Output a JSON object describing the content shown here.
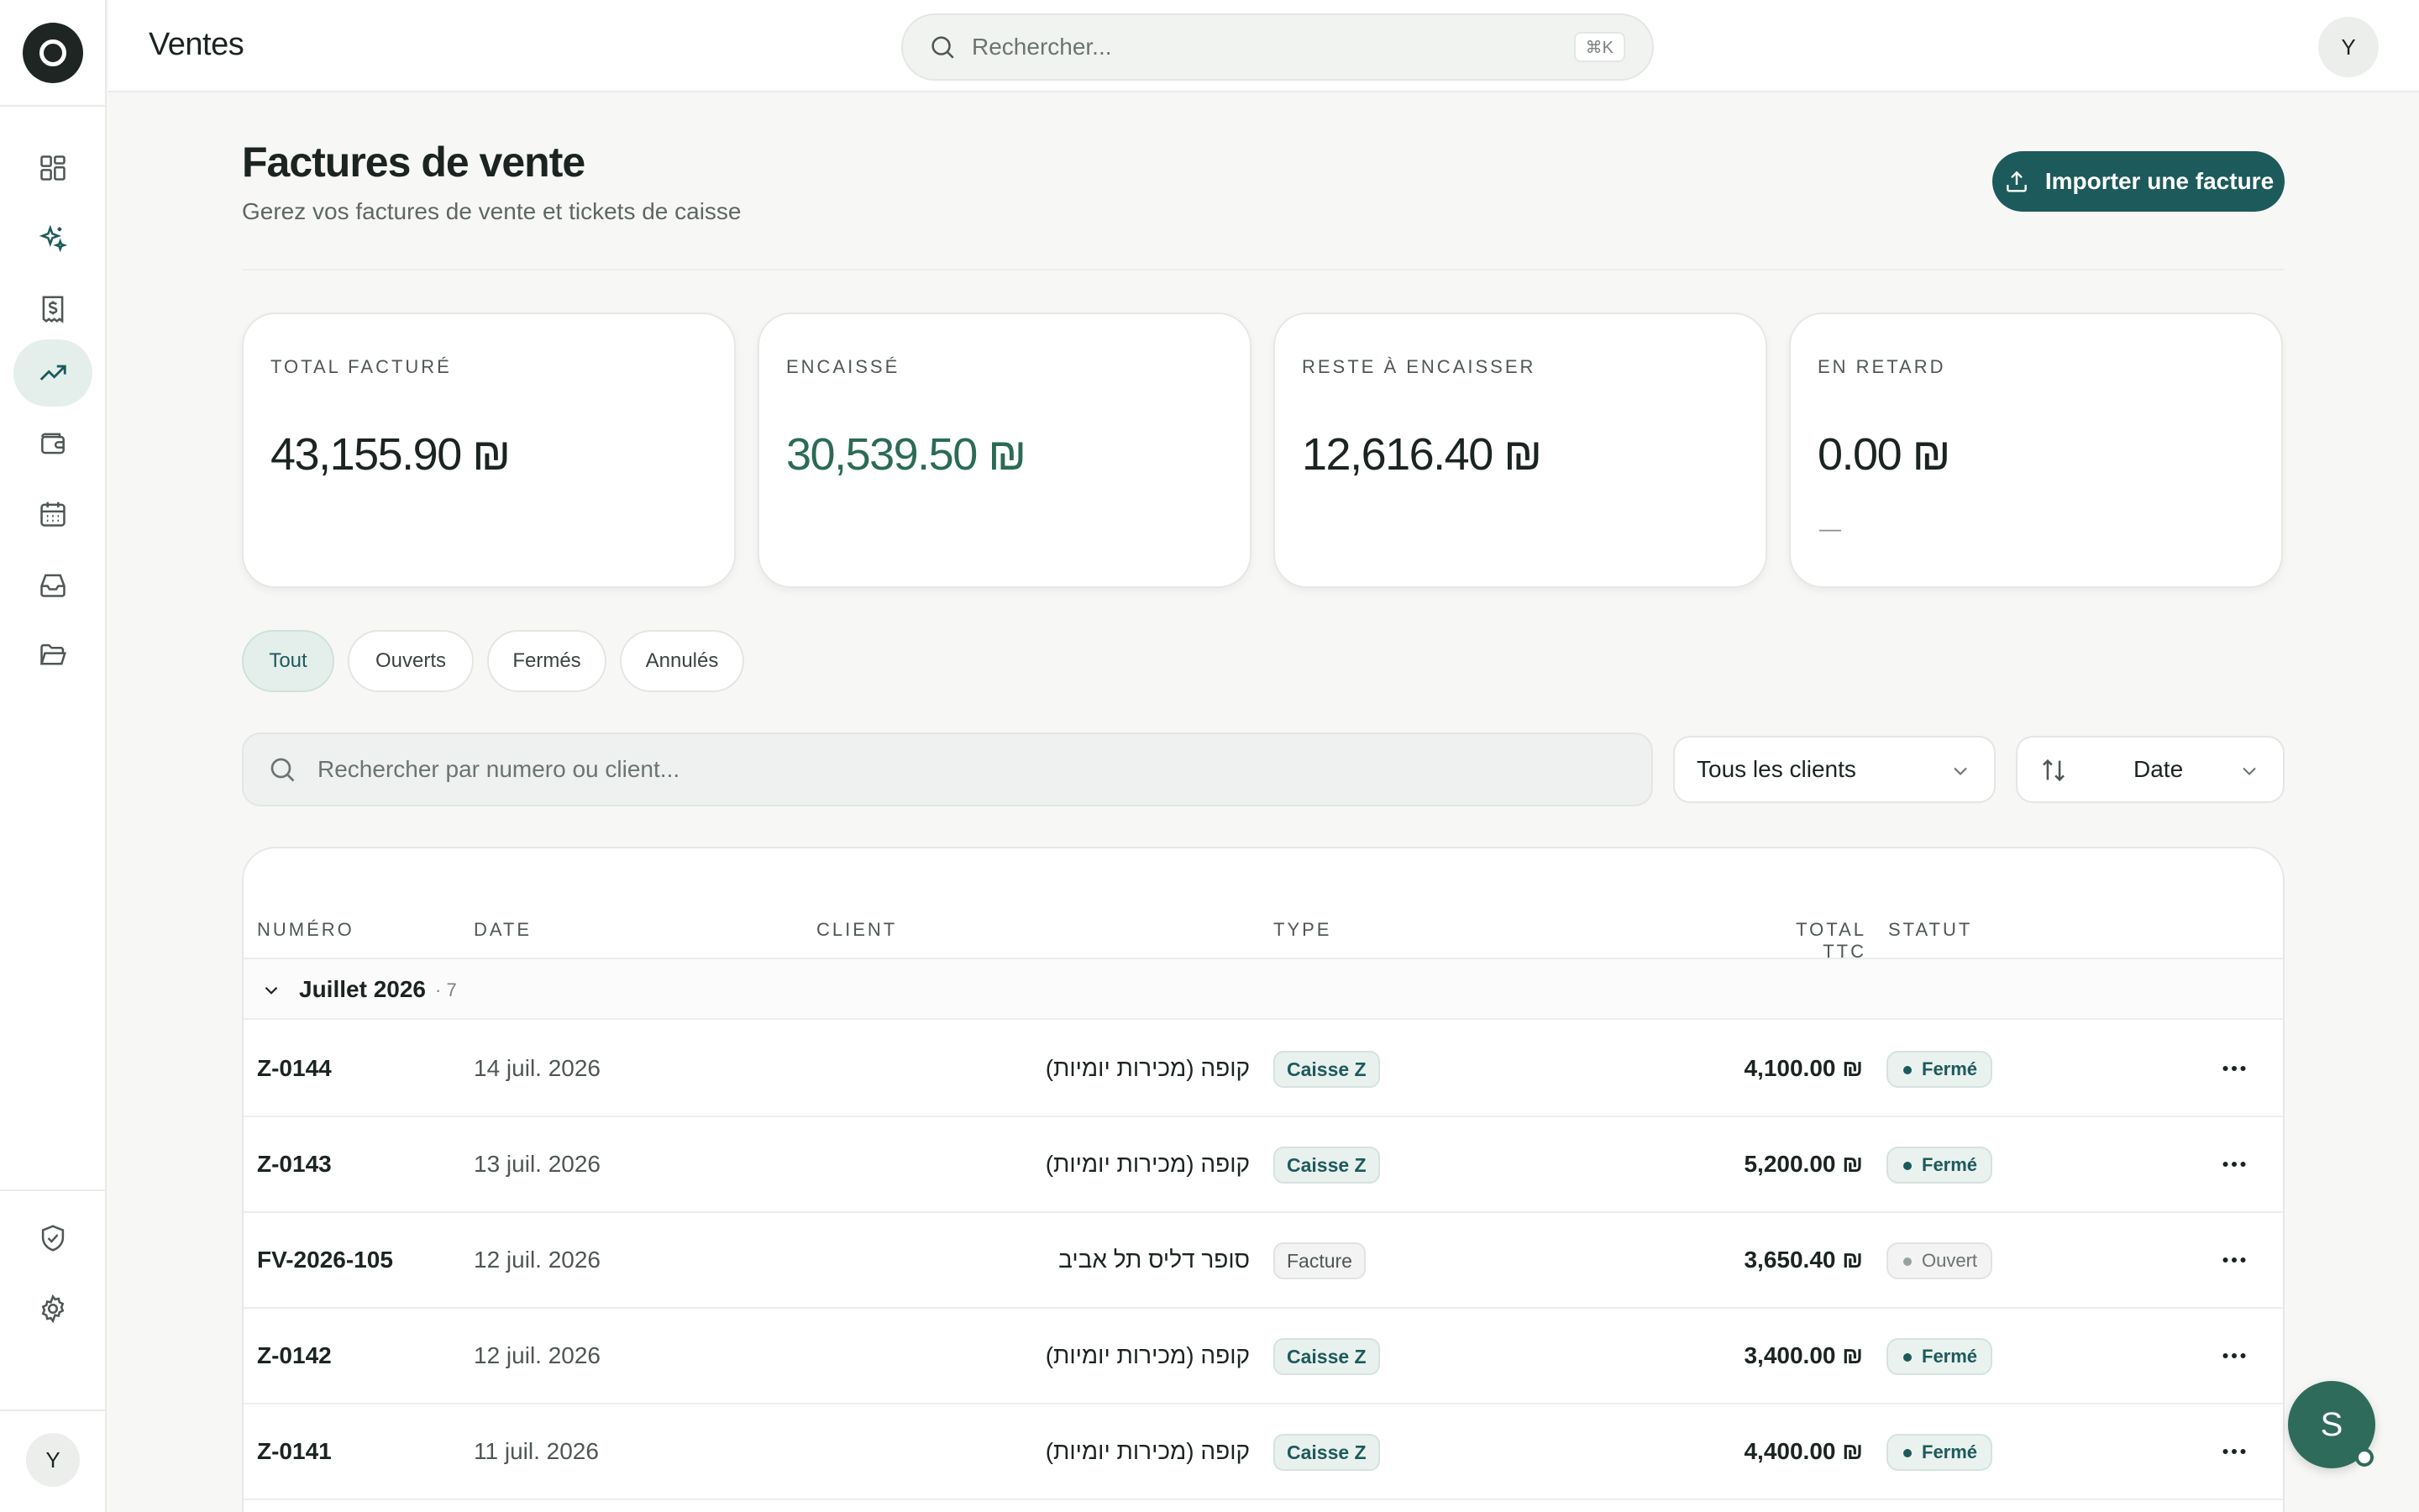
{
  "app": {
    "title": "Ventes"
  },
  "search": {
    "placeholder": "Rechercher...",
    "shortcut": "⌘K"
  },
  "user": {
    "initial": "Y"
  },
  "sidebar": {
    "items": [
      {
        "name": "dashboard",
        "icon": "grid-icon",
        "active": false
      },
      {
        "name": "ai",
        "icon": "sparkles-icon",
        "active": false
      },
      {
        "name": "invoices",
        "icon": "receipt-dollar-icon",
        "active": false
      },
      {
        "name": "sales",
        "icon": "trending-up-icon",
        "active": true
      },
      {
        "name": "wallet",
        "icon": "wallet-icon",
        "active": false
      },
      {
        "name": "calendar",
        "icon": "calendar-icon",
        "active": false
      },
      {
        "name": "inbox",
        "icon": "inbox-icon",
        "active": false
      },
      {
        "name": "documents",
        "icon": "folder-open-icon",
        "active": false
      }
    ],
    "bottom_items": [
      {
        "name": "security",
        "icon": "shield-check-icon"
      },
      {
        "name": "settings",
        "icon": "gear-icon"
      }
    ],
    "avatar_initial": "Y"
  },
  "page": {
    "title": "Factures de vente",
    "subtitle": "Gerez vos factures de vente et tickets de caisse",
    "import_label": "Importer une facture"
  },
  "stats": [
    {
      "label": "TOTAL FACTURÉ",
      "value": "43,155.90 ₪"
    },
    {
      "label": "ENCAISSÉ",
      "value": "30,539.50 ₪"
    },
    {
      "label": "RESTE À ENCAISSER",
      "value": "12,616.40 ₪"
    },
    {
      "label": "EN RETARD",
      "value": "0.00 ₪",
      "note": "—"
    }
  ],
  "filters": [
    {
      "label": "Tout",
      "active": true
    },
    {
      "label": "Ouverts",
      "active": false
    },
    {
      "label": "Fermés",
      "active": false
    },
    {
      "label": "Annulés",
      "active": false
    }
  ],
  "list_search": {
    "placeholder": "Rechercher par numero ou client..."
  },
  "client_filter": {
    "value": "Tous les clients"
  },
  "sort": {
    "value": "Date"
  },
  "table": {
    "columns": {
      "number": "NUMÉRO",
      "date": "DATE",
      "client": "CLIENT",
      "type": "TYPE",
      "total": "TOTAL TTC",
      "status": "STATUT"
    },
    "group": {
      "name": "Juillet 2026",
      "count": "· 7"
    },
    "rows": [
      {
        "number": "Z-0144",
        "date": "14 juil. 2026",
        "client": "קופה (מכירות יומיות)",
        "type": "Caisse Z",
        "total": "4,100.00 ₪",
        "status": "Fermé"
      },
      {
        "number": "Z-0143",
        "date": "13 juil. 2026",
        "client": "קופה (מכירות יומיות)",
        "type": "Caisse Z",
        "total": "5,200.00 ₪",
        "status": "Fermé"
      },
      {
        "number": "FV-2026-105",
        "date": "12 juil. 2026",
        "client": "סופר דליס תל אביב",
        "type": "Facture",
        "total": "3,650.40 ₪",
        "status": "Ouvert"
      },
      {
        "number": "Z-0142",
        "date": "12 juil. 2026",
        "client": "קופה (מכירות יומיות)",
        "type": "Caisse Z",
        "total": "3,400.00 ₪",
        "status": "Fermé"
      },
      {
        "number": "Z-0141",
        "date": "11 juil. 2026",
        "client": "קופה (מכירות יומיות)",
        "type": "Caisse Z",
        "total": "4,400.00 ₪",
        "status": "Fermé"
      }
    ]
  },
  "assistant": {
    "initial": "S"
  },
  "colors": {
    "accent": "#1d5a5b",
    "positive": "#2b6b55",
    "active_bg": "#e4efeb"
  }
}
